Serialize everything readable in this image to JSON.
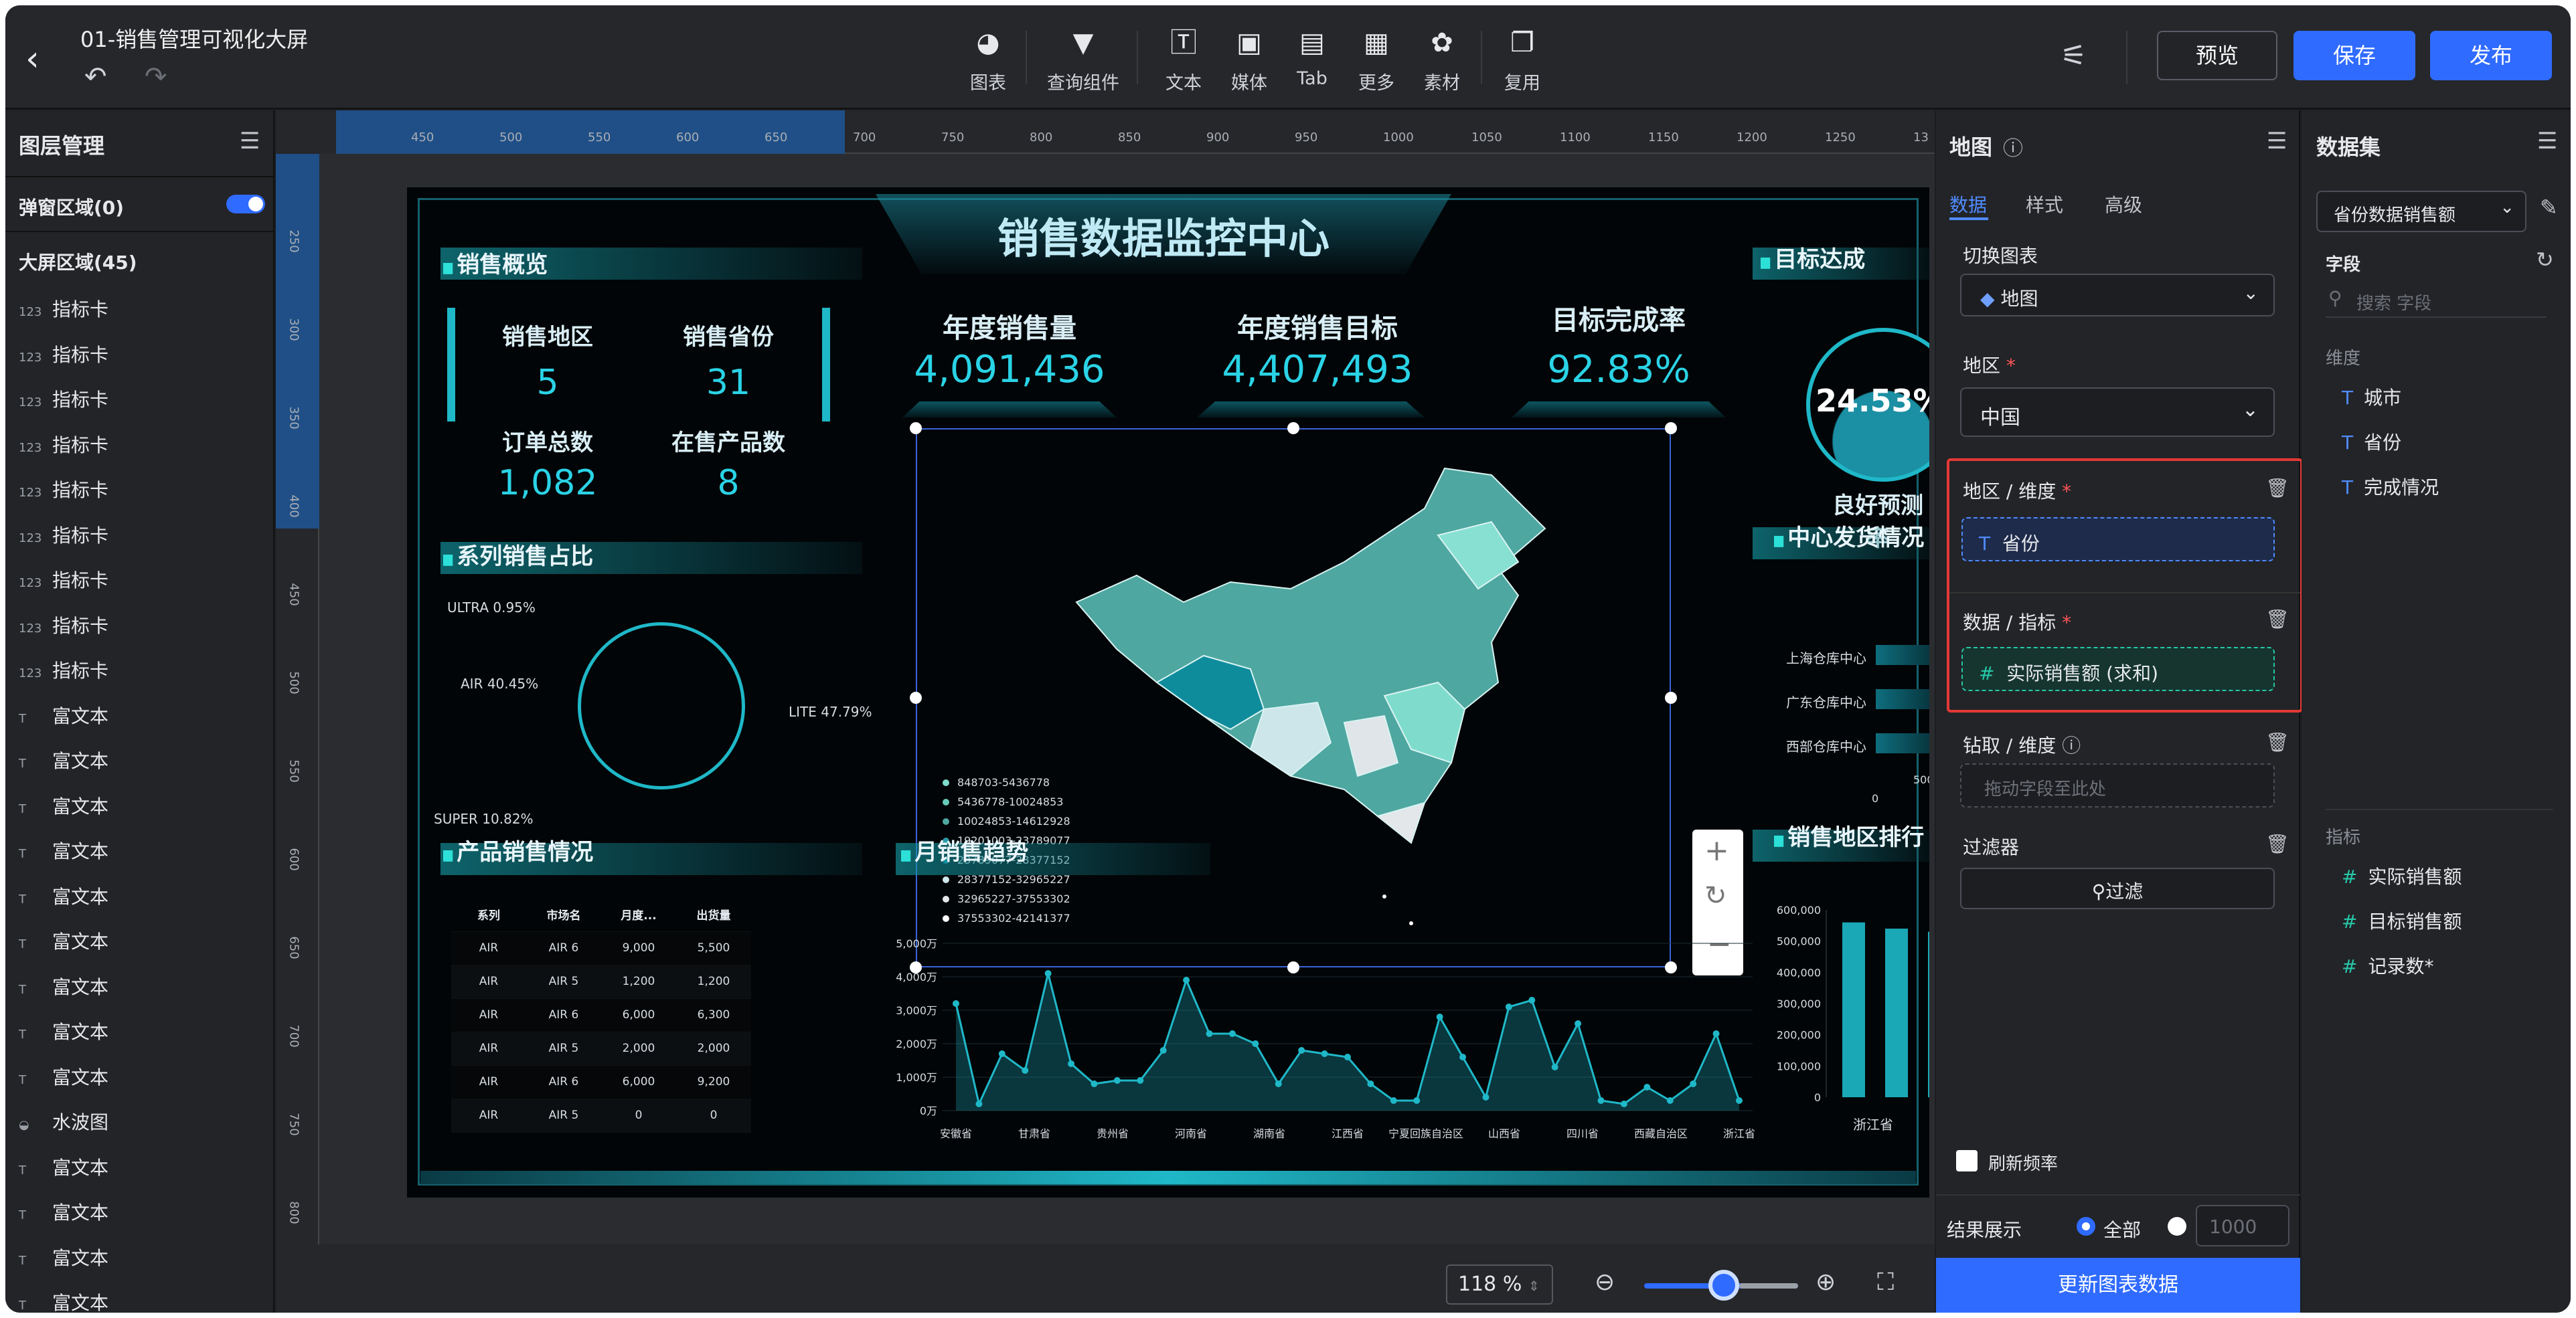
{
  "app": {
    "title": "01-销售管理可视化大屏"
  },
  "toolbar": {
    "tools": [
      {
        "label": "图表",
        "icon": "pie-chart-icon"
      },
      {
        "label": "查询组件",
        "icon": "filter-icon"
      },
      {
        "label": "文本",
        "icon": "text-icon"
      },
      {
        "label": "媒体",
        "icon": "image-icon"
      },
      {
        "label": "Tab",
        "icon": "tab-icon"
      },
      {
        "label": "更多",
        "icon": "grid-icon"
      },
      {
        "label": "素材",
        "icon": "palette-icon"
      },
      {
        "label": "复用",
        "icon": "copy-icon"
      }
    ],
    "preview": "预览",
    "save": "保存",
    "publish": "发布"
  },
  "layers": {
    "title": "图层管理",
    "popup_region": "弹窗区域(0)",
    "screen_region": "大屏区域(45)",
    "items": [
      {
        "type": "123",
        "label": "指标卡"
      },
      {
        "type": "123",
        "label": "指标卡"
      },
      {
        "type": "123",
        "label": "指标卡"
      },
      {
        "type": "123",
        "label": "指标卡"
      },
      {
        "type": "123",
        "label": "指标卡"
      },
      {
        "type": "123",
        "label": "指标卡"
      },
      {
        "type": "123",
        "label": "指标卡"
      },
      {
        "type": "123",
        "label": "指标卡"
      },
      {
        "type": "123",
        "label": "指标卡"
      },
      {
        "type": "T",
        "label": "富文本"
      },
      {
        "type": "T",
        "label": "富文本"
      },
      {
        "type": "T",
        "label": "富文本"
      },
      {
        "type": "T",
        "label": "富文本"
      },
      {
        "type": "T",
        "label": "富文本"
      },
      {
        "type": "T",
        "label": "富文本"
      },
      {
        "type": "T",
        "label": "富文本"
      },
      {
        "type": "T",
        "label": "富文本"
      },
      {
        "type": "T",
        "label": "富文本"
      },
      {
        "type": "◒",
        "label": "水波图"
      },
      {
        "type": "T",
        "label": "富文本"
      },
      {
        "type": "T",
        "label": "富文本"
      },
      {
        "type": "T",
        "label": "富文本"
      },
      {
        "type": "T",
        "label": "富文本"
      }
    ]
  },
  "rulers": {
    "top": [
      "450",
      "500",
      "550",
      "600",
      "650",
      "700",
      "750",
      "800",
      "850",
      "900",
      "950",
      "1000",
      "1050",
      "1100",
      "1150",
      "1200",
      "1250",
      "13"
    ],
    "left": [
      "250",
      "300",
      "350",
      "400",
      "450",
      "500",
      "550",
      "600",
      "650",
      "700",
      "750",
      "800"
    ]
  },
  "zoom": {
    "value": "118",
    "unit": "%"
  },
  "dashboard": {
    "title": "销售数据监控中心",
    "overview_title": "销售概览",
    "kpis": [
      {
        "label": "销售地区",
        "value": "5"
      },
      {
        "label": "销售省份",
        "value": "31"
      },
      {
        "label": "订单总数",
        "value": "1,082"
      },
      {
        "label": "在售产品数",
        "value": "8"
      }
    ],
    "top_kpis": [
      {
        "label": "年度销售量",
        "value": "4,091,436"
      },
      {
        "label": "年度销售目标",
        "value": "4,407,493"
      },
      {
        "label": "目标完成率",
        "value": "92.83%"
      }
    ],
    "target_title": "目标达成",
    "target_value": "24.53%",
    "target_label": "良好预测率",
    "series_title": "系列销售占比",
    "pie_labels": [
      "ULTRA 0.95%",
      "AIR 40.45%",
      "LITE 47.79%",
      "SUPER 10.82%"
    ],
    "product_title": "产品销售情况",
    "product_table": {
      "headers": [
        "系列",
        "市场名",
        "月度...",
        "出货量"
      ],
      "rows": [
        [
          "AIR",
          "AIR 6",
          "9,000",
          "5,500"
        ],
        [
          "AIR",
          "AIR 5",
          "1,200",
          "1,200"
        ],
        [
          "AIR",
          "AIR 6",
          "6,000",
          "6,300"
        ],
        [
          "AIR",
          "AIR 5",
          "2,000",
          "2,000"
        ],
        [
          "AIR",
          "AIR 6",
          "6,000",
          "9,200"
        ],
        [
          "AIR",
          "AIR 5",
          "0",
          "0"
        ]
      ]
    },
    "map_legend": [
      "848703-5436778",
      "5436778-10024853",
      "10024853-14612928",
      "19201003-23789077",
      "23789077-28377152",
      "28377152-32965227",
      "32965227-37553302",
      "37553302-42141377"
    ],
    "trend_title": "月销售趋势",
    "shipping_title": "中心发货情况",
    "shipping_rows": [
      "上海仓库中心",
      "广东仓库中心",
      "西部仓库中心"
    ],
    "shipping_axis": [
      "0",
      "500,"
    ],
    "rank_title": "销售地区排行",
    "rank_yaxis": [
      "600,000",
      "500,000",
      "400,000",
      "300,000",
      "200,000",
      "100,000",
      "0"
    ],
    "rank_xlabel": "浙江省"
  },
  "chart_data": [
    {
      "type": "line",
      "title": "月销售趋势",
      "categories": [
        "安徽省",
        "甘肃省",
        "贵州省",
        "河南省",
        "湖南省",
        "江西省",
        "宁夏回族自治区",
        "山西省",
        "四川省",
        "西藏自治区",
        "浙江省"
      ],
      "y_ticks": [
        "0万",
        "1,000万",
        "2,000万",
        "3,000万",
        "4,000万",
        "5,000万"
      ],
      "ylim": [
        0,
        5000
      ],
      "values": [
        3200,
        200,
        1700,
        1200,
        4100,
        1400,
        800,
        900,
        900,
        1800,
        3900,
        2300,
        2300,
        2000,
        800,
        1800,
        1700,
        1600,
        800,
        300,
        300,
        2800,
        1600,
        400,
        3100,
        3300,
        1300,
        2600,
        300,
        200,
        700,
        300,
        800,
        2300,
        300
      ]
    },
    {
      "type": "bar",
      "title": "销售地区排行",
      "categories": [
        "浙江省"
      ],
      "series": [
        {
          "values": [
            560000,
            540000,
            530000
          ]
        }
      ],
      "ylim": [
        0,
        600000
      ]
    }
  ],
  "props": {
    "title": "地图",
    "tabs": [
      "数据",
      "样式",
      "高级"
    ],
    "switch_label": "切换图表",
    "chart_type": "地图",
    "region_label": "地区",
    "region_value": "中国",
    "dim_label": "地区 / 维度",
    "dim_value": "省份",
    "metric_label": "数据 / 指标",
    "metric_value": "实际销售额 (求和)",
    "drill_label": "钻取 / 维度",
    "drill_placeholder": "拖动字段至此处",
    "filter_label": "过滤器",
    "filter_button": "过滤",
    "refresh_label": "刷新频率",
    "result_label": "结果展示",
    "result_all": "全部",
    "result_limit": "1000",
    "update_button": "更新图表数据"
  },
  "dataset": {
    "title": "数据集",
    "selected": "省份数据销售额",
    "fields_label": "字段",
    "search_placeholder": "搜索 字段",
    "dims_label": "维度",
    "dims": [
      "城市",
      "省份",
      "完成情况"
    ],
    "metrics_label": "指标",
    "metrics": [
      "实际销售额",
      "目标销售额",
      "记录数*"
    ]
  }
}
